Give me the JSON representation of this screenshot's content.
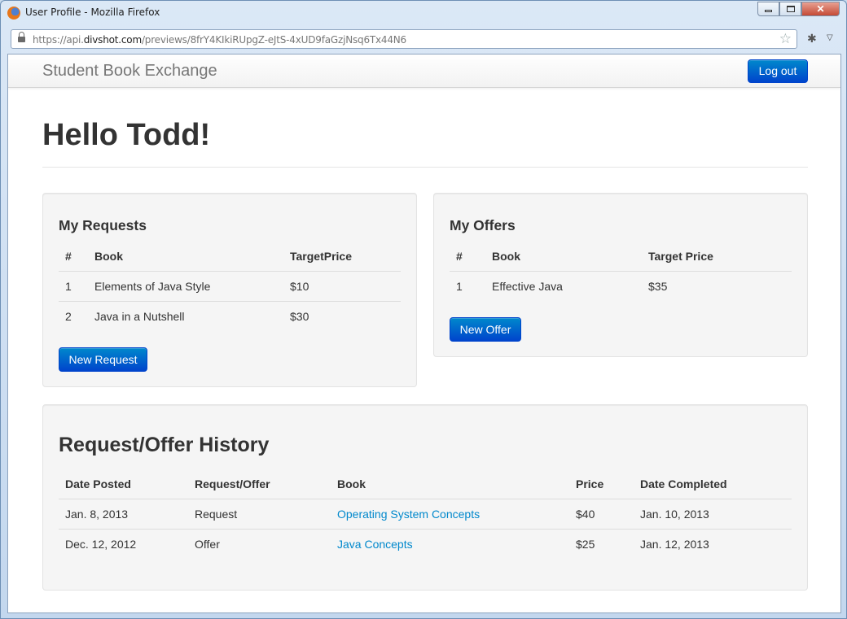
{
  "window": {
    "title": "User Profile - Mozilla Firefox",
    "url_prefix": "https://api.",
    "url_domain": "divshot.com",
    "url_path": "/previews/8frY4KIkiRUpgZ-eJtS-4xUD9faGzjNsq6Tx44N6"
  },
  "topbar": {
    "brand": "Student Book Exchange",
    "logout_label": "Log out"
  },
  "greeting": "Hello Todd!",
  "requests": {
    "heading": "My Requests",
    "columns": [
      "#",
      "Book",
      "TargetPrice"
    ],
    "rows": [
      [
        "1",
        "Elements of Java Style",
        "$10"
      ],
      [
        "2",
        "Java in a Nutshell",
        "$30"
      ]
    ],
    "button_label": "New Request"
  },
  "offers": {
    "heading": "My Offers",
    "columns": [
      "#",
      "Book",
      "Target Price"
    ],
    "rows": [
      [
        "1",
        "Effective Java",
        "$35"
      ]
    ],
    "button_label": "New Offer"
  },
  "history": {
    "heading": "Request/Offer History",
    "columns": [
      "Date Posted",
      "Request/Offer",
      "Book",
      "Price",
      "Date Completed"
    ],
    "rows": [
      [
        "Jan. 8, 2013",
        "Request",
        "Operating System Concepts",
        "$40",
        "Jan. 10, 2013"
      ],
      [
        "Dec. 12, 2012",
        "Offer",
        "Java Concepts",
        "$25",
        "Jan. 12, 2013"
      ]
    ]
  },
  "colors": {
    "primary_button": "#0044cc",
    "link": "#0088cc",
    "well_bg": "#f5f5f5"
  },
  "icons": [
    "firefox-logo-icon",
    "lock-icon",
    "bookmark-star-icon",
    "addon-icon",
    "dropdown-arrow-icon",
    "minimize-icon",
    "maximize-icon",
    "close-icon"
  ]
}
